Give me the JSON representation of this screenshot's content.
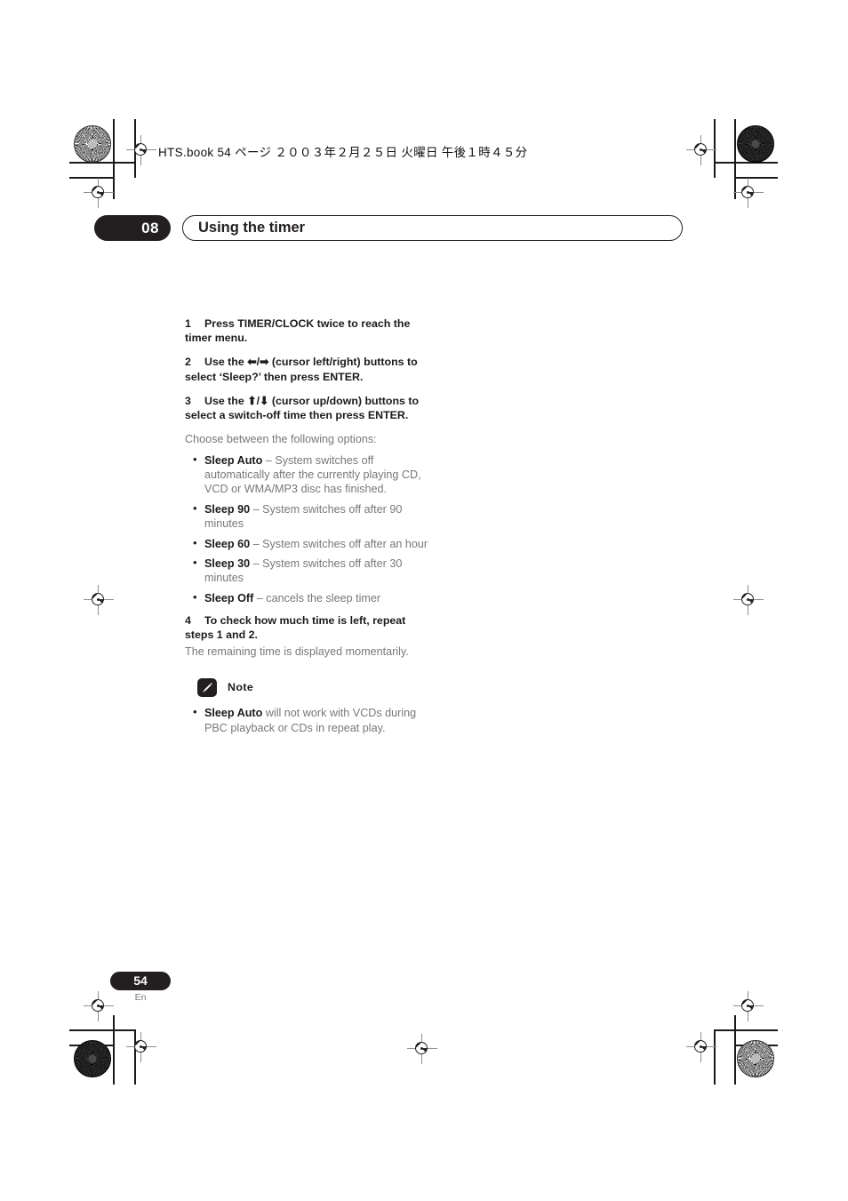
{
  "print_slug": "HTS.book 54 ページ ２００３年２月２５日 火曜日 午後１時４５分",
  "chapter": {
    "number": "08",
    "title": "Using the timer"
  },
  "steps": [
    {
      "num": "1",
      "text": "Press TIMER/CLOCK twice to reach the timer menu."
    },
    {
      "num": "2",
      "pre": "Use the ",
      "arrows": "⬅/➡",
      "post": " (cursor left/right) buttons to select ‘Sleep?’ then press ENTER."
    },
    {
      "num": "3",
      "pre": "Use the ",
      "arrows": "⬆/⬇",
      "post": " (cursor up/down) buttons to select a switch-off time then press ENTER."
    },
    {
      "num": "4",
      "text": "To check how much time is left, repeat steps 1 and 2."
    }
  ],
  "intro_options": "Choose between the following options:",
  "options": [
    {
      "label": "Sleep Auto",
      "desc": " – System switches off automatically after the currently playing CD, VCD or WMA/MP3 disc has finished."
    },
    {
      "label": "Sleep 90",
      "desc": " – System switches off after 90 minutes"
    },
    {
      "label": "Sleep 60",
      "desc": " – System switches off after an hour"
    },
    {
      "label": "Sleep 30",
      "desc": " – System switches off after 30 minutes"
    },
    {
      "label": "Sleep Off",
      "desc": " – cancels the sleep timer"
    }
  ],
  "step4_note": "The remaining time is displayed momentarily.",
  "note": {
    "icon": "pencil-icon",
    "label": "Note",
    "items": [
      {
        "label": "Sleep Auto",
        "desc": " will not work with VCDs during PBC playback or CDs in repeat play."
      }
    ]
  },
  "footer": {
    "page_number": "54",
    "language": "En"
  },
  "colors": {
    "ink": "#231f20",
    "body_gray": "#77787b",
    "page": "#ffffff"
  }
}
